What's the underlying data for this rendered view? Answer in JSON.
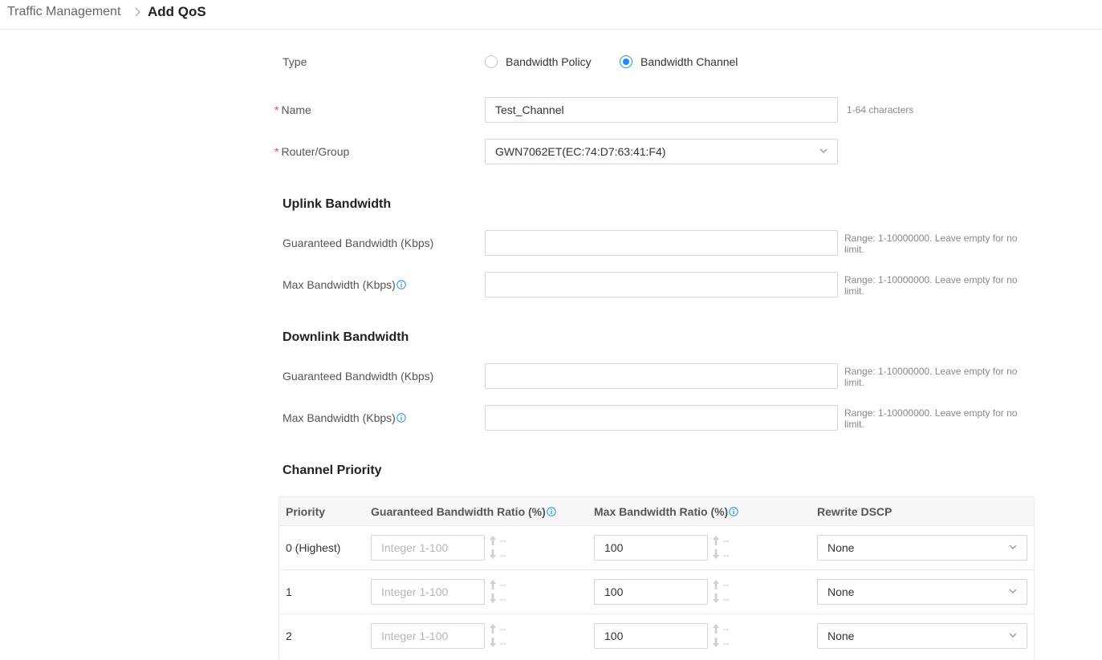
{
  "breadcrumb": {
    "root": "Traffic Management",
    "current": "Add QoS"
  },
  "form": {
    "type_label": "Type",
    "type_options": [
      "Bandwidth Policy",
      "Bandwidth Channel"
    ],
    "type_selected": "Bandwidth Channel",
    "name_label": "Name",
    "name_value": "Test_Channel",
    "name_hint": "1-64 characters",
    "router_label": "Router/Group",
    "router_value": "GWN7062ET(EC:74:D7:63:41:F4)"
  },
  "uplink": {
    "title": "Uplink Bandwidth",
    "guaranteed_label": "Guaranteed Bandwidth (Kbps)",
    "guaranteed_value": "",
    "guaranteed_hint": "Range: 1-10000000. Leave empty for no limit.",
    "max_label": "Max Bandwidth (Kbps)",
    "max_value": "",
    "max_hint": "Range: 1-10000000. Leave empty for no limit."
  },
  "downlink": {
    "title": "Downlink Bandwidth",
    "guaranteed_label": "Guaranteed Bandwidth (Kbps)",
    "guaranteed_value": "",
    "guaranteed_hint": "Range: 1-10000000. Leave empty for no limit.",
    "max_label": "Max Bandwidth (Kbps)",
    "max_value": "",
    "max_hint": "Range: 1-10000000. Leave empty for no limit."
  },
  "channel_priority": {
    "title": "Channel Priority",
    "columns": [
      "Priority",
      "Guaranteed Bandwidth Ratio (%)",
      "Max Bandwidth Ratio (%)",
      "Rewrite DSCP"
    ],
    "stepper_dash": "--",
    "rows": [
      {
        "priority": "0 (Highest)",
        "guaranteed_placeholder": "Integer 1-100",
        "max_value": "100",
        "dscp": "None"
      },
      {
        "priority": "1",
        "guaranteed_placeholder": "Integer 1-100",
        "max_value": "100",
        "dscp": "None"
      },
      {
        "priority": "2",
        "guaranteed_placeholder": "Integer 1-100",
        "max_value": "100",
        "dscp": "None"
      }
    ]
  },
  "colors": {
    "accent": "#1a8cff",
    "required": "#e8474c"
  },
  "icons": {
    "breadcrumb_separator": "chevron-right-icon",
    "select_arrow": "chevron-down-icon",
    "info": "info-icon",
    "stepper": "arrow-up-down-icon"
  }
}
